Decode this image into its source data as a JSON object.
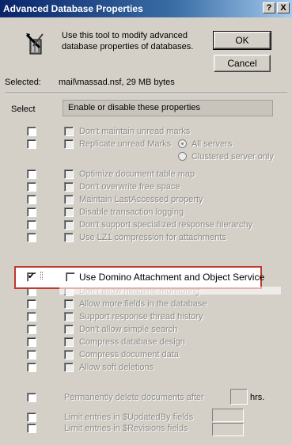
{
  "window": {
    "title": "Advanced Database Properties",
    "help_label": "?",
    "close_label": "X"
  },
  "intro": {
    "text": "Use this tool to modify advanced database properties of databases.",
    "icon": "database-tool-icon"
  },
  "buttons": {
    "ok": "OK",
    "cancel": "Cancel"
  },
  "selected": {
    "label": "Selected:",
    "value": "mail\\massad.nsf, 29 MB bytes"
  },
  "table_header": {
    "select": "Select",
    "properties": "Enable or disable these properties"
  },
  "group1": [
    {
      "label": "Don't maintain unread marks",
      "select_checked": false,
      "enabled": false
    },
    {
      "label": "Replicate unread Marks",
      "select_checked": false,
      "enabled": false
    }
  ],
  "radio_options": [
    {
      "label": "All servers",
      "selected": true
    },
    {
      "label": "Clustered server only",
      "selected": false
    }
  ],
  "group2": [
    {
      "label": "Optimize document table map",
      "select_checked": false
    },
    {
      "label": "Don't overwrite free space",
      "select_checked": false
    },
    {
      "label": "Maintain LastAccessed property",
      "select_checked": false
    },
    {
      "label": "Disable transaction logging",
      "select_checked": false
    },
    {
      "label": "Don't support specialized response hierarchy",
      "select_checked": false
    },
    {
      "label": "Use LZ1 compression for attachments",
      "select_checked": false
    }
  ],
  "highlighted": {
    "label": "Use Domino Attachment and Object Service",
    "select_checked": true,
    "enabled": false
  },
  "group3": [
    {
      "label": "Don't allow headline monitoring",
      "select_checked": false
    },
    {
      "label": "Allow more fields in the database",
      "select_checked": false
    },
    {
      "label": "Support response thread history",
      "select_checked": false
    },
    {
      "label": "Don't allow simple search",
      "select_checked": false
    },
    {
      "label": "Compress database design",
      "select_checked": false
    },
    {
      "label": "Compress document data",
      "select_checked": false
    },
    {
      "label": "Allow soft deletions",
      "select_checked": false
    }
  ],
  "delete_after": {
    "label": "Permanently delete documents after",
    "value": "",
    "unit": "hrs."
  },
  "limits": [
    {
      "label": "Limit entries in $UpdatedBy fields",
      "value": ""
    },
    {
      "label": "Limit entries in $Revisions fields",
      "value": ""
    }
  ]
}
